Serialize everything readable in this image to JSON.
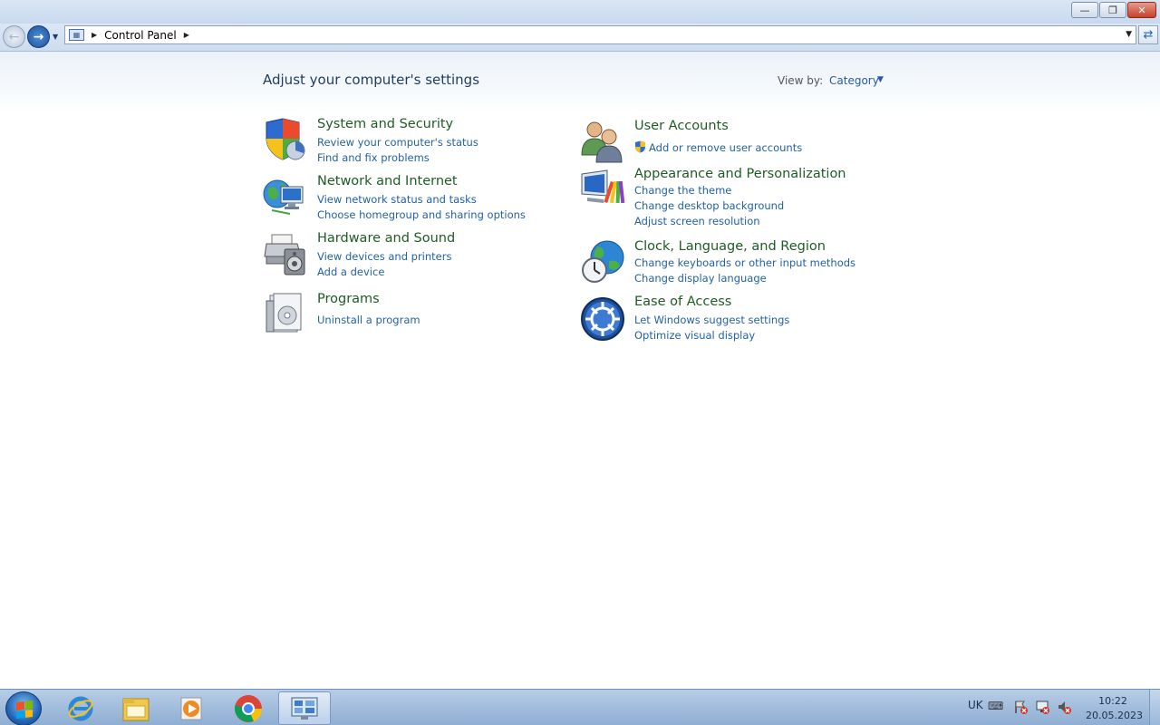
{
  "window": {
    "minimize_icon": "minimize-icon",
    "maximize_icon": "restore-icon",
    "close_icon": "close-icon"
  },
  "navbar": {
    "breadcrumb": "Control Panel"
  },
  "content": {
    "heading": "Adjust your computer's settings",
    "view_by_label": "View by:",
    "view_by_value": "Category"
  },
  "categories": [
    {
      "title": "System and Security",
      "icon": "shield-icon",
      "links": [
        "Review your computer's status",
        "Find and fix problems"
      ]
    },
    {
      "title": "Network and Internet",
      "icon": "network-globe-icon",
      "links": [
        "View network status and tasks",
        "Choose homegroup and sharing options"
      ]
    },
    {
      "title": "Hardware and Sound",
      "icon": "printer-speaker-icon",
      "links": [
        "View devices and printers",
        "Add a device"
      ]
    },
    {
      "title": "Programs",
      "icon": "programs-icon",
      "links": [
        "Uninstall a program"
      ]
    },
    {
      "title": "User Accounts",
      "icon": "users-icon",
      "links": [
        "Add or remove user accounts"
      ]
    },
    {
      "title": "Appearance and Personalization",
      "icon": "monitor-paint-icon",
      "links": [
        "Change the theme",
        "Change desktop background",
        "Adjust screen resolution"
      ]
    },
    {
      "title": "Clock, Language, and Region",
      "icon": "globe-clock-icon",
      "links": [
        "Change keyboards or other input methods",
        "Change display language"
      ]
    },
    {
      "title": "Ease of Access",
      "icon": "ease-of-access-icon",
      "links": [
        "Let Windows suggest settings",
        "Optimize visual display"
      ]
    }
  ],
  "taskbar": {
    "apps": [
      "internet-explorer-icon",
      "file-explorer-icon",
      "media-player-icon",
      "chrome-icon",
      "control-panel-icon"
    ],
    "language": "UK",
    "time": "10:22",
    "date": "20.05.2023"
  },
  "colors": {
    "category_title": "#1e5c24",
    "link": "#2262a6",
    "heading": "#1e3d5e"
  }
}
